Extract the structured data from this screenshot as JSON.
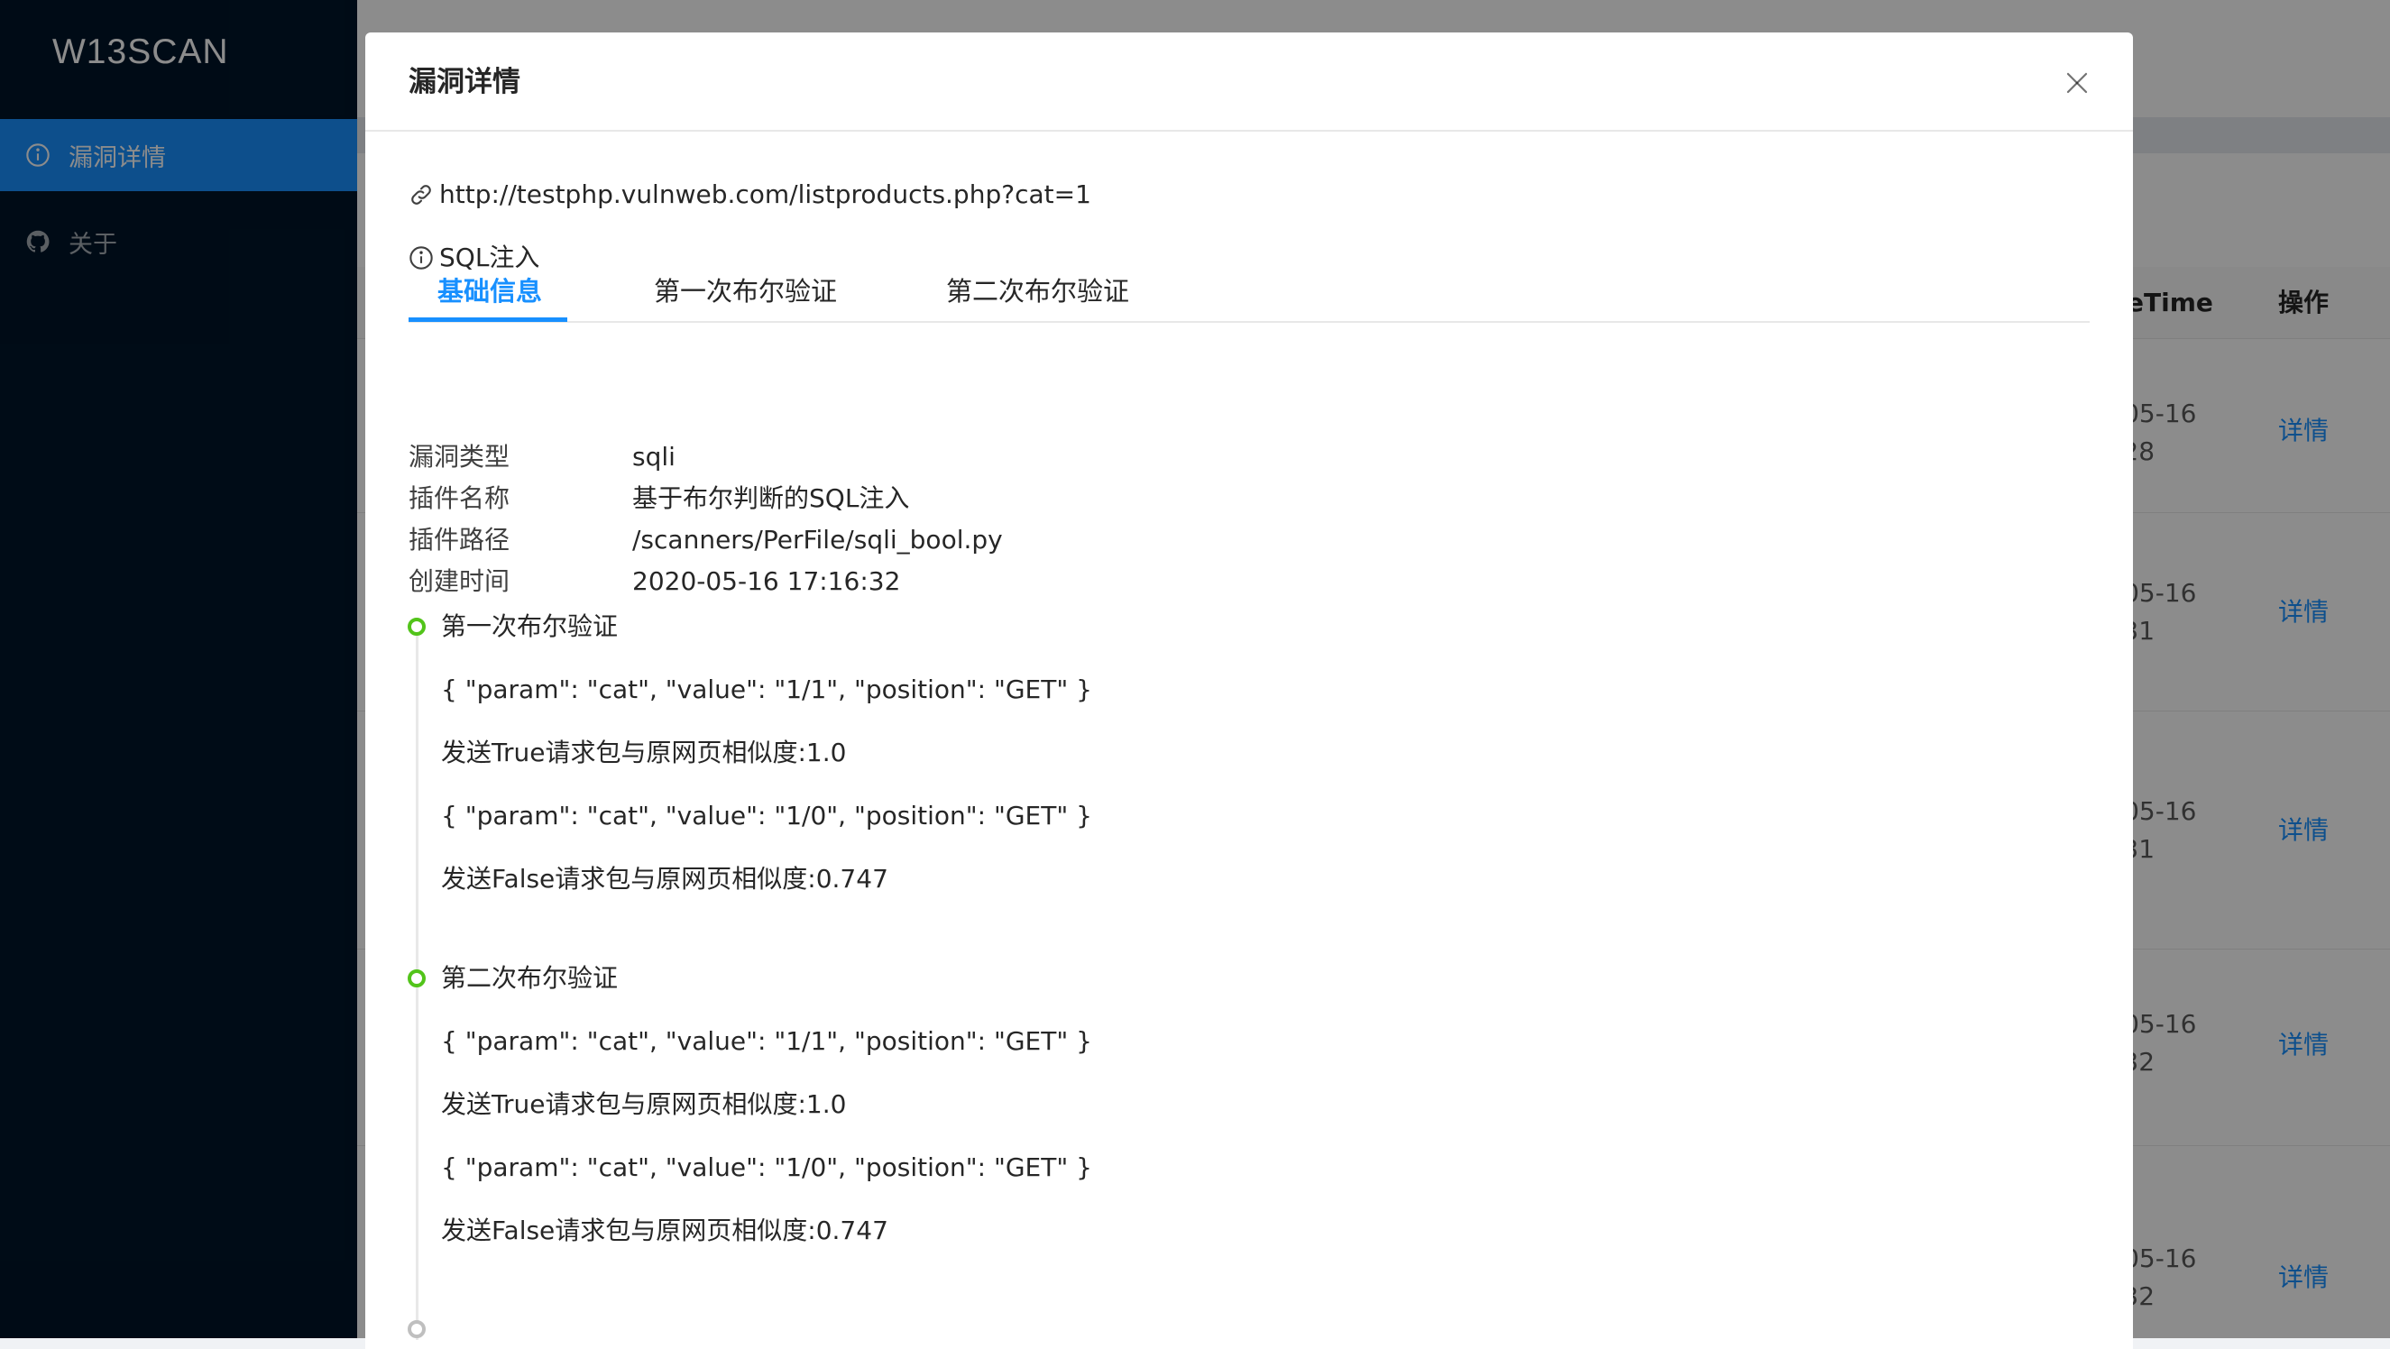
{
  "app": {
    "brand": "W13SCAN"
  },
  "sidebar": {
    "items": [
      {
        "label": "漏洞详情",
        "icon": "info-circle-icon",
        "active": true
      },
      {
        "label": "关于",
        "icon": "github-icon",
        "active": false
      }
    ]
  },
  "background_table": {
    "headers": {
      "time": "eTime",
      "action": "操作"
    },
    "rows": [
      {
        "time": "-05-16\n:28",
        "action": "详情"
      },
      {
        "time": "-05-16\n:31",
        "action": "详情"
      },
      {
        "time": "-05-16\n:31",
        "action": "详情"
      },
      {
        "time": "-05-16\n:32",
        "action": "详情"
      },
      {
        "time": "-05-16\n:32",
        "action": "详情"
      }
    ]
  },
  "modal": {
    "title": "漏洞详情",
    "url": "http://testphp.vulnweb.com/listproducts.php?cat=1",
    "vuln_name": "SQL注入",
    "tabs": [
      "基础信息",
      "第一次布尔验证",
      "第二次布尔验证"
    ],
    "active_tab": 0,
    "details": [
      {
        "label": "漏洞类型",
        "value": "sqli"
      },
      {
        "label": "插件名称",
        "value": "基于布尔判断的SQL注入"
      },
      {
        "label": "插件路径",
        "value": "/scanners/PerFile/sqli_bool.py"
      },
      {
        "label": "创建时间",
        "value": "2020-05-16 17:16:32"
      }
    ],
    "timeline": [
      {
        "title": "第一次布尔验证",
        "lines": [
          "{ \"param\": \"cat\", \"value\": \"1/1\", \"position\": \"GET\" }",
          "发送True请求包与原网页相似度:1.0",
          "{ \"param\": \"cat\", \"value\": \"1/0\", \"position\": \"GET\" }",
          "发送False请求包与原网页相似度:0.747"
        ]
      },
      {
        "title": "第二次布尔验证",
        "lines": [
          "{ \"param\": \"cat\", \"value\": \"1/1\", \"position\": \"GET\" }",
          "发送True请求包与原网页相似度:1.0",
          "{ \"param\": \"cat\", \"value\": \"1/0\", \"position\": \"GET\" }",
          "发送False请求包与原网页相似度:0.747"
        ]
      }
    ]
  },
  "colors": {
    "primary": "#1890ff",
    "sidebar_bg": "#001529",
    "timeline_green": "#52c41a"
  }
}
